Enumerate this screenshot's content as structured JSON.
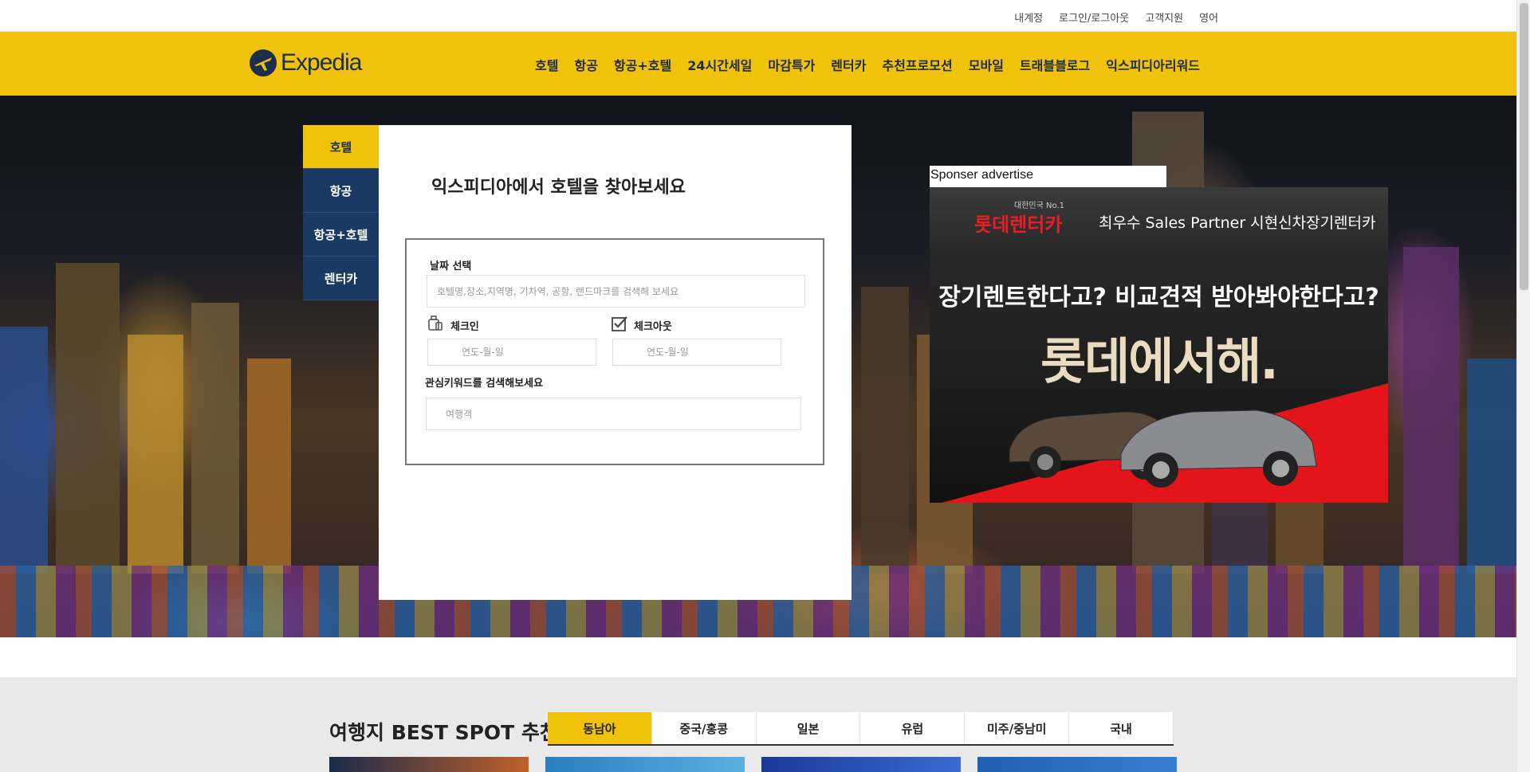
{
  "util_links": [
    "내계정",
    "로그인/로그아웃",
    "고객지원",
    "영어"
  ],
  "brand": {
    "name": "Expedia",
    "color": "#1c2e4e"
  },
  "gnb": [
    "호텔",
    "항공",
    "항공+호텔",
    "24시간세일",
    "마감특가",
    "렌터카",
    "추천프로모션",
    "모바일",
    "트래블블로그",
    "익스피디아리워드"
  ],
  "search": {
    "tabs": [
      "호텔",
      "항공",
      "항공+호텔",
      "렌터카"
    ],
    "active_tab": 0,
    "title": "익스피디아에서 호텔을 찾아보세요",
    "date_label": "날짜 선택",
    "destination_placeholder": "호텔명,장소,지역명, 기차역, 공항, 랜드마크를 검색해 보세요",
    "checkin_label": "체크인",
    "checkin_placeholder": "연도-월-일",
    "checkout_label": "체크아웃",
    "checkout_placeholder": "연도-월-일",
    "keyword_label": "관심키워드를 검색해보세요",
    "keyword_placeholder": "여행객"
  },
  "ad": {
    "label": "Sponser advertise",
    "small": "대한민국 No.1",
    "brand": "롯데렌터카",
    "partner": "최우수 Sales Partner 시현신차장기렌터카",
    "headline": "장기렌트한다고? 비교견적 받아봐야한다고?",
    "big": "롯데에서해."
  },
  "best_spot": {
    "title": "여행지 BEST SPOT 추천",
    "tabs": [
      "동남아",
      "중국/홍콩",
      "일본",
      "유럽",
      "미주/중남미",
      "국내"
    ],
    "active_tab": 0
  },
  "colors": {
    "accent": "#f0c20c",
    "navy": "#1a3a64"
  }
}
